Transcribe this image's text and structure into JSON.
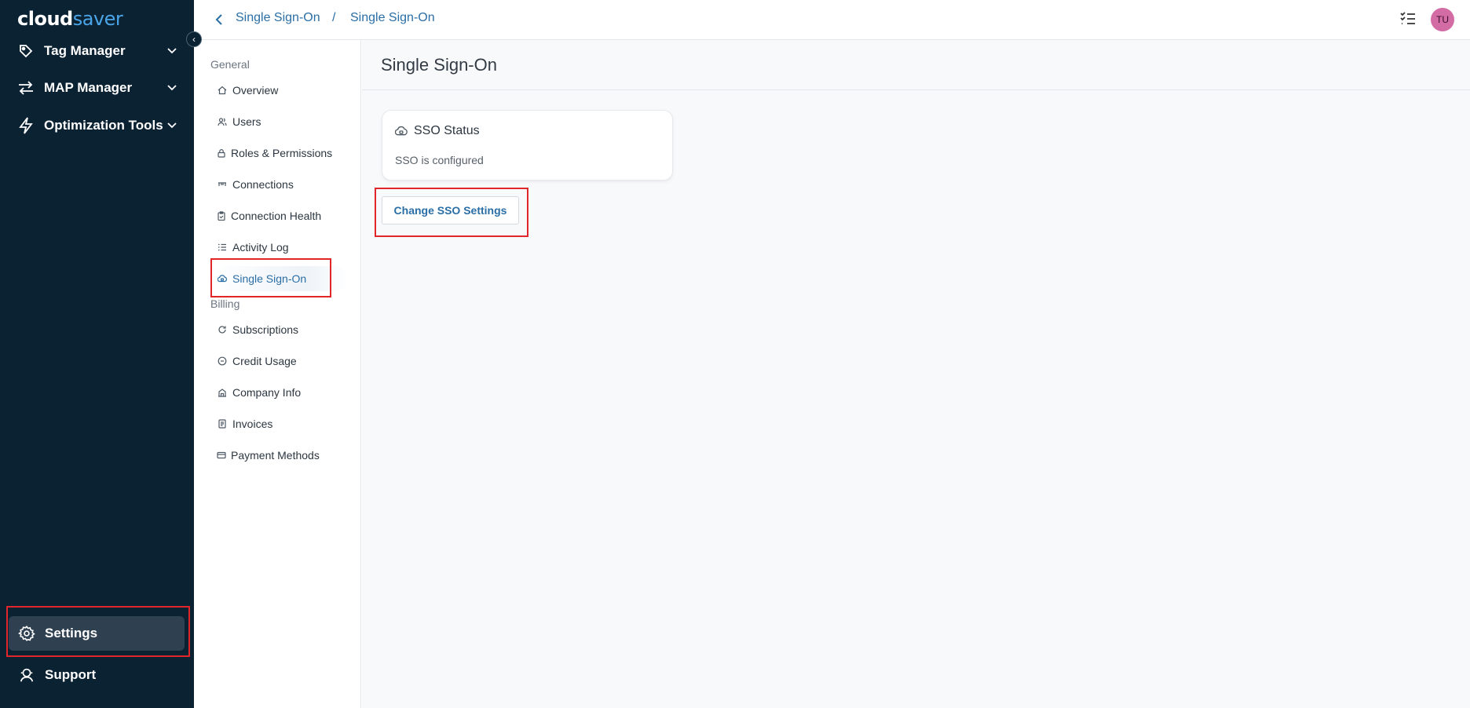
{
  "app": {
    "logo_part1": "cloud",
    "logo_part2": "saver"
  },
  "sidebar": {
    "items": [
      {
        "label": "Tag Manager",
        "icon": "tag-icon"
      },
      {
        "label": "MAP Manager",
        "icon": "arrows-icon"
      },
      {
        "label": "Optimization Tools",
        "icon": "lightning-icon"
      }
    ],
    "settings_label": "Settings",
    "support_label": "Support"
  },
  "header": {
    "breadcrumb": [
      "Single Sign-On",
      "Single Sign-On"
    ],
    "separator": "/",
    "avatar_initials": "TU"
  },
  "submenu": {
    "general_label": "General",
    "general_items": [
      {
        "label": "Overview",
        "icon": "home-icon"
      },
      {
        "label": "Users",
        "icon": "users-icon"
      },
      {
        "label": "Roles & Permissions",
        "icon": "lock-icon"
      },
      {
        "label": "Connections",
        "icon": "connections-icon"
      },
      {
        "label": "Connection Health",
        "icon": "clipboard-icon"
      },
      {
        "label": "Activity Log",
        "icon": "list-icon"
      },
      {
        "label": "Single Sign-On",
        "icon": "cloud-lock-icon"
      }
    ],
    "billing_label": "Billing",
    "billing_items": [
      {
        "label": "Subscriptions",
        "icon": "subscriptions-icon"
      },
      {
        "label": "Credit Usage",
        "icon": "credit-icon"
      },
      {
        "label": "Company Info",
        "icon": "building-icon"
      },
      {
        "label": "Invoices",
        "icon": "invoice-icon"
      },
      {
        "label": "Payment Methods",
        "icon": "card-icon"
      }
    ]
  },
  "main": {
    "title": "Single Sign-On",
    "card_title": "SSO Status",
    "card_text": "SSO is configured",
    "button_label": "Change SSO Settings"
  },
  "colors": {
    "sidebar_bg": "#0b2233",
    "accent": "#2a6ea6",
    "highlight": "#e0252b"
  }
}
